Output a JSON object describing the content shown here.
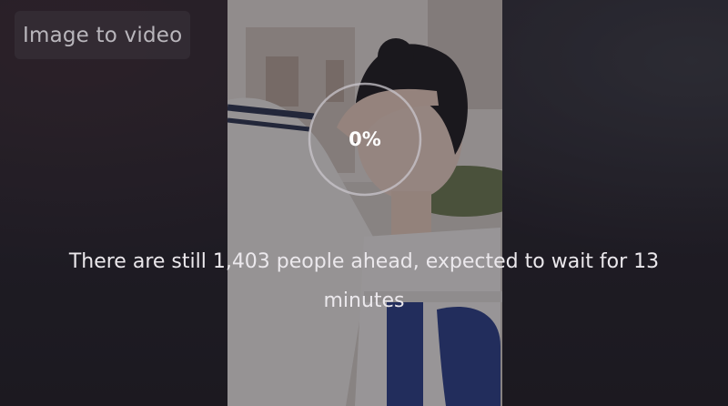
{
  "badge": {
    "label": "Image to video"
  },
  "progress": {
    "percent": 0,
    "label": "0%"
  },
  "queue": {
    "message": "There are still 1,403 people ahead, expected to wait for 13 minutes"
  },
  "colors": {
    "background": "#232027",
    "ring": "#c9c6cc",
    "text": "#ebe8ec"
  }
}
